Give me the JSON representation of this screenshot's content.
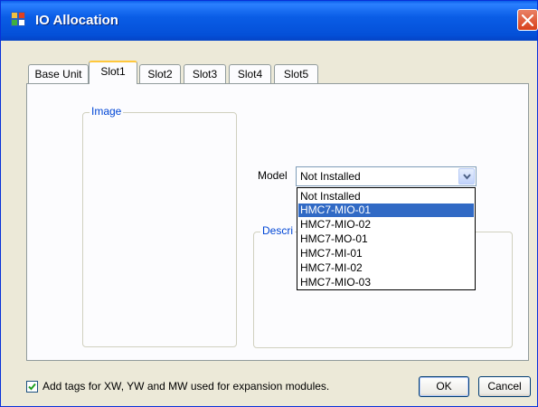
{
  "window": {
    "title": "IO Allocation"
  },
  "tabs": [
    {
      "label": "Base Unit"
    },
    {
      "label": "Slot1"
    },
    {
      "label": "Slot2"
    },
    {
      "label": "Slot3"
    },
    {
      "label": "Slot4"
    },
    {
      "label": "Slot5"
    }
  ],
  "active_tab": "Slot1",
  "image_group": {
    "label": "Image"
  },
  "description_group": {
    "label": "Descri"
  },
  "model": {
    "label": "Model",
    "value": "Not Installed",
    "options": [
      "Not Installed",
      "HMC7-MIO-01",
      "HMC7-MIO-02",
      "HMC7-MO-01",
      "HMC7-MI-01",
      "HMC7-MI-02",
      "HMC7-MIO-03"
    ],
    "highlighted_option": "HMC7-MIO-01"
  },
  "add_tags": {
    "label": "Add tags for XW, YW and MW used for expansion  modules.",
    "checked": true
  },
  "buttons": {
    "ok": "OK",
    "cancel": "Cancel"
  },
  "colors": {
    "titlebar": "#0a5de6",
    "selection": "#316ac5",
    "group_label": "#0046d5",
    "tab_highlight": "#ffc83c"
  }
}
